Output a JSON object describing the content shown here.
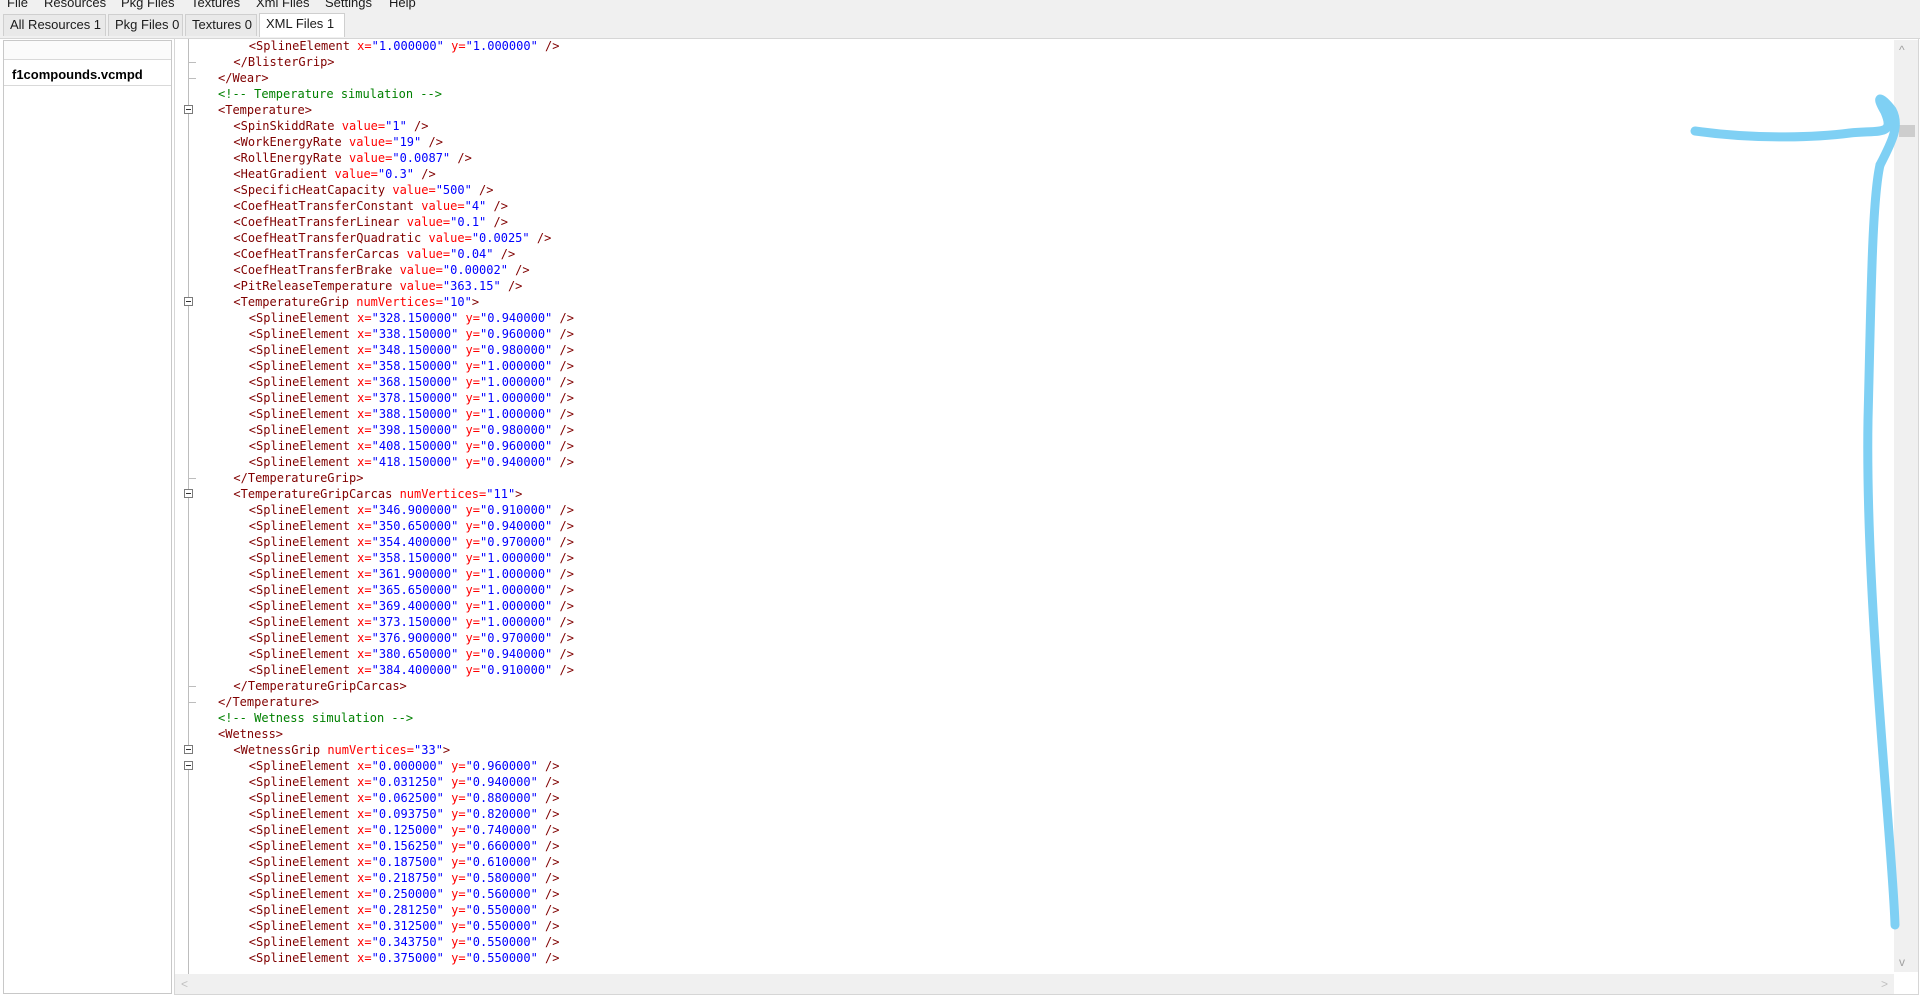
{
  "menu": [
    "File",
    "Resources",
    "Pkg Files",
    "Textures",
    "Xml Files",
    "Settings",
    "Help"
  ],
  "tabs": [
    {
      "label": "All Resources 1"
    },
    {
      "label": "Pkg Files 0"
    },
    {
      "label": "Textures 0"
    },
    {
      "label": "XML Files 1"
    }
  ],
  "active_tab": "XML Files 1",
  "file_list": [
    "f1compounds.vcmpd"
  ],
  "annotation": {
    "shape": "hand-drawn arrow pointing to vertical scrollbar thumb",
    "color": "#7fd0f4"
  },
  "code_lines": [
    {
      "indent": 2,
      "tokens": [
        [
          "t",
          "<SplineElement "
        ],
        [
          "a",
          "x="
        ],
        [
          "v",
          "\"1.000000\""
        ],
        [
          "a",
          " y="
        ],
        [
          "v",
          "\"1.000000\""
        ],
        [
          "t",
          " />"
        ]
      ]
    },
    {
      "indent": 1,
      "tokens": [
        [
          "t",
          "</BlisterGrip>"
        ]
      ]
    },
    {
      "indent": 0,
      "tokens": [
        [
          "t",
          "</Wear>"
        ]
      ]
    },
    {
      "indent": 0,
      "tokens": [
        [
          "c",
          "<!-- Temperature simulation -->"
        ]
      ]
    },
    {
      "indent": 0,
      "tokens": [
        [
          "t",
          "<Temperature>"
        ]
      ]
    },
    {
      "indent": 1,
      "tokens": [
        [
          "t",
          "<SpinSkiddRate "
        ],
        [
          "a",
          "value="
        ],
        [
          "v",
          "\"1\""
        ],
        [
          "t",
          " />"
        ]
      ]
    },
    {
      "indent": 1,
      "tokens": [
        [
          "t",
          "<WorkEnergyRate "
        ],
        [
          "a",
          "value="
        ],
        [
          "v",
          "\"19\""
        ],
        [
          "t",
          " />"
        ]
      ]
    },
    {
      "indent": 1,
      "tokens": [
        [
          "t",
          "<RollEnergyRate "
        ],
        [
          "a",
          "value="
        ],
        [
          "v",
          "\"0.0087\""
        ],
        [
          "t",
          " />"
        ]
      ]
    },
    {
      "indent": 1,
      "tokens": [
        [
          "t",
          "<HeatGradient "
        ],
        [
          "a",
          "value="
        ],
        [
          "v",
          "\"0.3\""
        ],
        [
          "t",
          " />"
        ]
      ]
    },
    {
      "indent": 1,
      "tokens": [
        [
          "t",
          "<SpecificHeatCapacity "
        ],
        [
          "a",
          "value="
        ],
        [
          "v",
          "\"500\""
        ],
        [
          "t",
          " />"
        ]
      ]
    },
    {
      "indent": 1,
      "tokens": [
        [
          "t",
          "<CoefHeatTransferConstant "
        ],
        [
          "a",
          "value="
        ],
        [
          "v",
          "\"4\""
        ],
        [
          "t",
          " />"
        ]
      ]
    },
    {
      "indent": 1,
      "tokens": [
        [
          "t",
          "<CoefHeatTransferLinear "
        ],
        [
          "a",
          "value="
        ],
        [
          "v",
          "\"0.1\""
        ],
        [
          "t",
          " />"
        ]
      ]
    },
    {
      "indent": 1,
      "tokens": [
        [
          "t",
          "<CoefHeatTransferQuadratic "
        ],
        [
          "a",
          "value="
        ],
        [
          "v",
          "\"0.0025\""
        ],
        [
          "t",
          " />"
        ]
      ]
    },
    {
      "indent": 1,
      "tokens": [
        [
          "t",
          "<CoefHeatTransferCarcas "
        ],
        [
          "a",
          "value="
        ],
        [
          "v",
          "\"0.04\""
        ],
        [
          "t",
          " />"
        ]
      ]
    },
    {
      "indent": 1,
      "tokens": [
        [
          "t",
          "<CoefHeatTransferBrake "
        ],
        [
          "a",
          "value="
        ],
        [
          "v",
          "\"0.00002\""
        ],
        [
          "t",
          " />"
        ]
      ]
    },
    {
      "indent": 1,
      "tokens": [
        [
          "t",
          "<PitReleaseTemperature "
        ],
        [
          "a",
          "value="
        ],
        [
          "v",
          "\"363.15\""
        ],
        [
          "t",
          " />"
        ]
      ]
    },
    {
      "indent": 1,
      "tokens": [
        [
          "t",
          "<TemperatureGrip "
        ],
        [
          "a",
          "numVertices="
        ],
        [
          "v",
          "\"10\""
        ],
        [
          "t",
          ">"
        ]
      ]
    },
    {
      "indent": 2,
      "tokens": [
        [
          "t",
          "<SplineElement "
        ],
        [
          "a",
          "x="
        ],
        [
          "v",
          "\"328.150000\""
        ],
        [
          "a",
          " y="
        ],
        [
          "v",
          "\"0.940000\""
        ],
        [
          "t",
          " />"
        ]
      ]
    },
    {
      "indent": 2,
      "tokens": [
        [
          "t",
          "<SplineElement "
        ],
        [
          "a",
          "x="
        ],
        [
          "v",
          "\"338.150000\""
        ],
        [
          "a",
          " y="
        ],
        [
          "v",
          "\"0.960000\""
        ],
        [
          "t",
          " />"
        ]
      ]
    },
    {
      "indent": 2,
      "tokens": [
        [
          "t",
          "<SplineElement "
        ],
        [
          "a",
          "x="
        ],
        [
          "v",
          "\"348.150000\""
        ],
        [
          "a",
          " y="
        ],
        [
          "v",
          "\"0.980000\""
        ],
        [
          "t",
          " />"
        ]
      ]
    },
    {
      "indent": 2,
      "tokens": [
        [
          "t",
          "<SplineElement "
        ],
        [
          "a",
          "x="
        ],
        [
          "v",
          "\"358.150000\""
        ],
        [
          "a",
          " y="
        ],
        [
          "v",
          "\"1.000000\""
        ],
        [
          "t",
          " />"
        ]
      ]
    },
    {
      "indent": 2,
      "tokens": [
        [
          "t",
          "<SplineElement "
        ],
        [
          "a",
          "x="
        ],
        [
          "v",
          "\"368.150000\""
        ],
        [
          "a",
          " y="
        ],
        [
          "v",
          "\"1.000000\""
        ],
        [
          "t",
          " />"
        ]
      ]
    },
    {
      "indent": 2,
      "tokens": [
        [
          "t",
          "<SplineElement "
        ],
        [
          "a",
          "x="
        ],
        [
          "v",
          "\"378.150000\""
        ],
        [
          "a",
          " y="
        ],
        [
          "v",
          "\"1.000000\""
        ],
        [
          "t",
          " />"
        ]
      ]
    },
    {
      "indent": 2,
      "tokens": [
        [
          "t",
          "<SplineElement "
        ],
        [
          "a",
          "x="
        ],
        [
          "v",
          "\"388.150000\""
        ],
        [
          "a",
          " y="
        ],
        [
          "v",
          "\"1.000000\""
        ],
        [
          "t",
          " />"
        ]
      ]
    },
    {
      "indent": 2,
      "tokens": [
        [
          "t",
          "<SplineElement "
        ],
        [
          "a",
          "x="
        ],
        [
          "v",
          "\"398.150000\""
        ],
        [
          "a",
          " y="
        ],
        [
          "v",
          "\"0.980000\""
        ],
        [
          "t",
          " />"
        ]
      ]
    },
    {
      "indent": 2,
      "tokens": [
        [
          "t",
          "<SplineElement "
        ],
        [
          "a",
          "x="
        ],
        [
          "v",
          "\"408.150000\""
        ],
        [
          "a",
          " y="
        ],
        [
          "v",
          "\"0.960000\""
        ],
        [
          "t",
          " />"
        ]
      ]
    },
    {
      "indent": 2,
      "tokens": [
        [
          "t",
          "<SplineElement "
        ],
        [
          "a",
          "x="
        ],
        [
          "v",
          "\"418.150000\""
        ],
        [
          "a",
          " y="
        ],
        [
          "v",
          "\"0.940000\""
        ],
        [
          "t",
          " />"
        ]
      ]
    },
    {
      "indent": 1,
      "tokens": [
        [
          "t",
          "</TemperatureGrip>"
        ]
      ]
    },
    {
      "indent": 1,
      "tokens": [
        [
          "t",
          "<TemperatureGripCarcas "
        ],
        [
          "a",
          "numVertices="
        ],
        [
          "v",
          "\"11\""
        ],
        [
          "t",
          ">"
        ]
      ]
    },
    {
      "indent": 2,
      "tokens": [
        [
          "t",
          "<SplineElement "
        ],
        [
          "a",
          "x="
        ],
        [
          "v",
          "\"346.900000\""
        ],
        [
          "a",
          " y="
        ],
        [
          "v",
          "\"0.910000\""
        ],
        [
          "t",
          " />"
        ]
      ]
    },
    {
      "indent": 2,
      "tokens": [
        [
          "t",
          "<SplineElement "
        ],
        [
          "a",
          "x="
        ],
        [
          "v",
          "\"350.650000\""
        ],
        [
          "a",
          " y="
        ],
        [
          "v",
          "\"0.940000\""
        ],
        [
          "t",
          " />"
        ]
      ]
    },
    {
      "indent": 2,
      "tokens": [
        [
          "t",
          "<SplineElement "
        ],
        [
          "a",
          "x="
        ],
        [
          "v",
          "\"354.400000\""
        ],
        [
          "a",
          " y="
        ],
        [
          "v",
          "\"0.970000\""
        ],
        [
          "t",
          " />"
        ]
      ]
    },
    {
      "indent": 2,
      "tokens": [
        [
          "t",
          "<SplineElement "
        ],
        [
          "a",
          "x="
        ],
        [
          "v",
          "\"358.150000\""
        ],
        [
          "a",
          " y="
        ],
        [
          "v",
          "\"1.000000\""
        ],
        [
          "t",
          " />"
        ]
      ]
    },
    {
      "indent": 2,
      "tokens": [
        [
          "t",
          "<SplineElement "
        ],
        [
          "a",
          "x="
        ],
        [
          "v",
          "\"361.900000\""
        ],
        [
          "a",
          " y="
        ],
        [
          "v",
          "\"1.000000\""
        ],
        [
          "t",
          " />"
        ]
      ]
    },
    {
      "indent": 2,
      "tokens": [
        [
          "t",
          "<SplineElement "
        ],
        [
          "a",
          "x="
        ],
        [
          "v",
          "\"365.650000\""
        ],
        [
          "a",
          " y="
        ],
        [
          "v",
          "\"1.000000\""
        ],
        [
          "t",
          " />"
        ]
      ]
    },
    {
      "indent": 2,
      "tokens": [
        [
          "t",
          "<SplineElement "
        ],
        [
          "a",
          "x="
        ],
        [
          "v",
          "\"369.400000\""
        ],
        [
          "a",
          " y="
        ],
        [
          "v",
          "\"1.000000\""
        ],
        [
          "t",
          " />"
        ]
      ]
    },
    {
      "indent": 2,
      "tokens": [
        [
          "t",
          "<SplineElement "
        ],
        [
          "a",
          "x="
        ],
        [
          "v",
          "\"373.150000\""
        ],
        [
          "a",
          " y="
        ],
        [
          "v",
          "\"1.000000\""
        ],
        [
          "t",
          " />"
        ]
      ]
    },
    {
      "indent": 2,
      "tokens": [
        [
          "t",
          "<SplineElement "
        ],
        [
          "a",
          "x="
        ],
        [
          "v",
          "\"376.900000\""
        ],
        [
          "a",
          " y="
        ],
        [
          "v",
          "\"0.970000\""
        ],
        [
          "t",
          " />"
        ]
      ]
    },
    {
      "indent": 2,
      "tokens": [
        [
          "t",
          "<SplineElement "
        ],
        [
          "a",
          "x="
        ],
        [
          "v",
          "\"380.650000\""
        ],
        [
          "a",
          " y="
        ],
        [
          "v",
          "\"0.940000\""
        ],
        [
          "t",
          " />"
        ]
      ]
    },
    {
      "indent": 2,
      "tokens": [
        [
          "t",
          "<SplineElement "
        ],
        [
          "a",
          "x="
        ],
        [
          "v",
          "\"384.400000\""
        ],
        [
          "a",
          " y="
        ],
        [
          "v",
          "\"0.910000\""
        ],
        [
          "t",
          " />"
        ]
      ]
    },
    {
      "indent": 1,
      "tokens": [
        [
          "t",
          "</TemperatureGripCarcas>"
        ]
      ]
    },
    {
      "indent": 0,
      "tokens": [
        [
          "t",
          "</Temperature>"
        ]
      ]
    },
    {
      "indent": 0,
      "tokens": [
        [
          "c",
          "<!-- Wetness simulation -->"
        ]
      ]
    },
    {
      "indent": 0,
      "tokens": [
        [
          "t",
          "<Wetness>"
        ]
      ]
    },
    {
      "indent": 1,
      "tokens": [
        [
          "t",
          "<WetnessGrip "
        ],
        [
          "a",
          "numVertices="
        ],
        [
          "v",
          "\"33\""
        ],
        [
          "t",
          ">"
        ]
      ]
    },
    {
      "indent": 2,
      "tokens": [
        [
          "t",
          "<SplineElement "
        ],
        [
          "a",
          "x="
        ],
        [
          "v",
          "\"0.000000\""
        ],
        [
          "a",
          " y="
        ],
        [
          "v",
          "\"0.960000\""
        ],
        [
          "t",
          " />"
        ]
      ]
    },
    {
      "indent": 2,
      "tokens": [
        [
          "t",
          "<SplineElement "
        ],
        [
          "a",
          "x="
        ],
        [
          "v",
          "\"0.031250\""
        ],
        [
          "a",
          " y="
        ],
        [
          "v",
          "\"0.940000\""
        ],
        [
          "t",
          " />"
        ]
      ]
    },
    {
      "indent": 2,
      "tokens": [
        [
          "t",
          "<SplineElement "
        ],
        [
          "a",
          "x="
        ],
        [
          "v",
          "\"0.062500\""
        ],
        [
          "a",
          " y="
        ],
        [
          "v",
          "\"0.880000\""
        ],
        [
          "t",
          " />"
        ]
      ]
    },
    {
      "indent": 2,
      "tokens": [
        [
          "t",
          "<SplineElement "
        ],
        [
          "a",
          "x="
        ],
        [
          "v",
          "\"0.093750\""
        ],
        [
          "a",
          " y="
        ],
        [
          "v",
          "\"0.820000\""
        ],
        [
          "t",
          " />"
        ]
      ]
    },
    {
      "indent": 2,
      "tokens": [
        [
          "t",
          "<SplineElement "
        ],
        [
          "a",
          "x="
        ],
        [
          "v",
          "\"0.125000\""
        ],
        [
          "a",
          " y="
        ],
        [
          "v",
          "\"0.740000\""
        ],
        [
          "t",
          " />"
        ]
      ]
    },
    {
      "indent": 2,
      "tokens": [
        [
          "t",
          "<SplineElement "
        ],
        [
          "a",
          "x="
        ],
        [
          "v",
          "\"0.156250\""
        ],
        [
          "a",
          " y="
        ],
        [
          "v",
          "\"0.660000\""
        ],
        [
          "t",
          " />"
        ]
      ]
    },
    {
      "indent": 2,
      "tokens": [
        [
          "t",
          "<SplineElement "
        ],
        [
          "a",
          "x="
        ],
        [
          "v",
          "\"0.187500\""
        ],
        [
          "a",
          " y="
        ],
        [
          "v",
          "\"0.610000\""
        ],
        [
          "t",
          " />"
        ]
      ]
    },
    {
      "indent": 2,
      "tokens": [
        [
          "t",
          "<SplineElement "
        ],
        [
          "a",
          "x="
        ],
        [
          "v",
          "\"0.218750\""
        ],
        [
          "a",
          " y="
        ],
        [
          "v",
          "\"0.580000\""
        ],
        [
          "t",
          " />"
        ]
      ]
    },
    {
      "indent": 2,
      "tokens": [
        [
          "t",
          "<SplineElement "
        ],
        [
          "a",
          "x="
        ],
        [
          "v",
          "\"0.250000\""
        ],
        [
          "a",
          " y="
        ],
        [
          "v",
          "\"0.560000\""
        ],
        [
          "t",
          " />"
        ]
      ]
    },
    {
      "indent": 2,
      "tokens": [
        [
          "t",
          "<SplineElement "
        ],
        [
          "a",
          "x="
        ],
        [
          "v",
          "\"0.281250\""
        ],
        [
          "a",
          " y="
        ],
        [
          "v",
          "\"0.550000\""
        ],
        [
          "t",
          " />"
        ]
      ]
    },
    {
      "indent": 2,
      "tokens": [
        [
          "t",
          "<SplineElement "
        ],
        [
          "a",
          "x="
        ],
        [
          "v",
          "\"0.312500\""
        ],
        [
          "a",
          " y="
        ],
        [
          "v",
          "\"0.550000\""
        ],
        [
          "t",
          " />"
        ]
      ]
    },
    {
      "indent": 2,
      "tokens": [
        [
          "t",
          "<SplineElement "
        ],
        [
          "a",
          "x="
        ],
        [
          "v",
          "\"0.343750\""
        ],
        [
          "a",
          " y="
        ],
        [
          "v",
          "\"0.550000\""
        ],
        [
          "t",
          " />"
        ]
      ]
    },
    {
      "indent": 2,
      "tokens": [
        [
          "t",
          "<SplineElement "
        ],
        [
          "a",
          "x="
        ],
        [
          "v",
          "\"0.375000\""
        ],
        [
          "a",
          " y="
        ],
        [
          "v",
          "\"0.550000\""
        ],
        [
          "t",
          " />"
        ]
      ]
    }
  ],
  "fold_markers_at_lines": [
    4,
    16,
    28,
    44,
    45
  ],
  "scroll": {
    "vertical_position_fraction": 0.06,
    "up_arrow": "^",
    "down_arrow": "v",
    "left_arrow": "<",
    "right_arrow": ">"
  }
}
